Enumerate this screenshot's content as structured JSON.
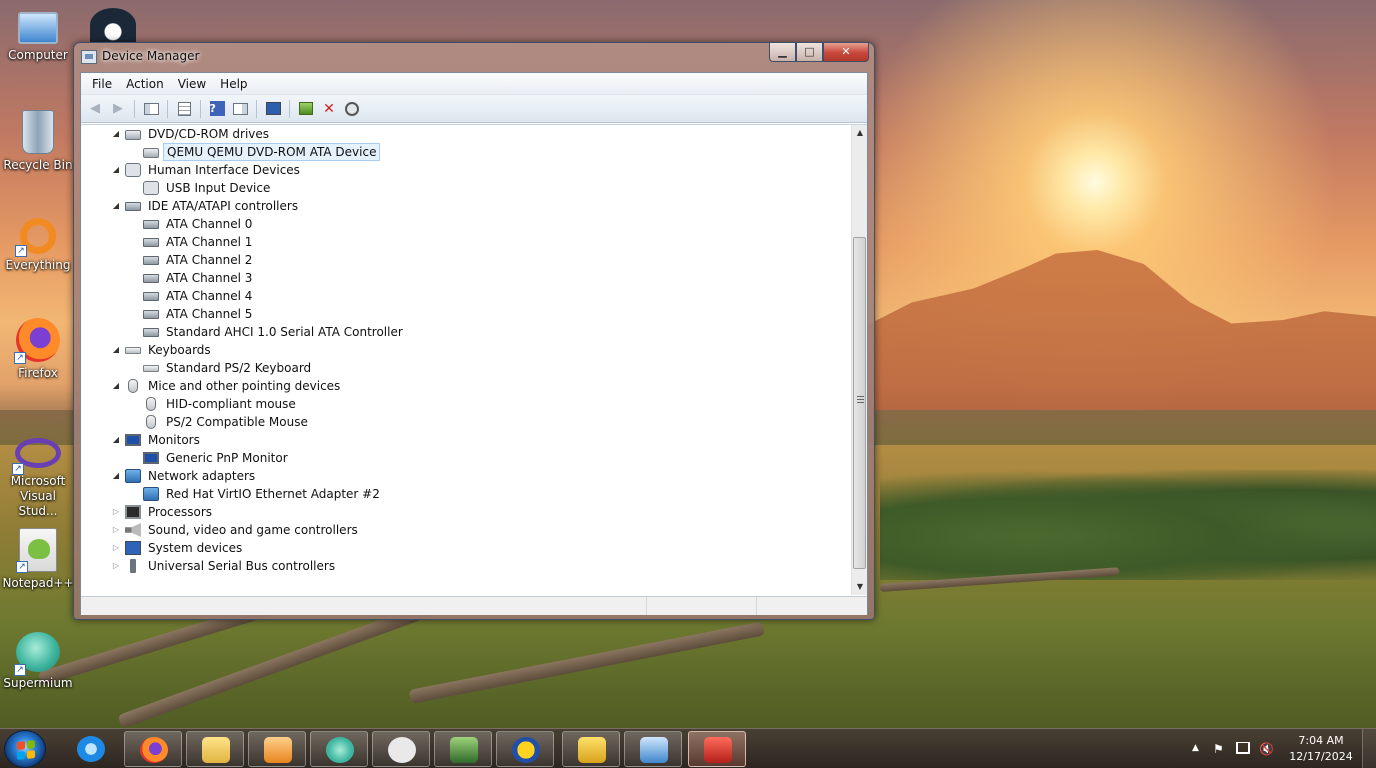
{
  "desktop": {
    "icons": [
      {
        "label": "Computer",
        "icon": "computer-icon"
      },
      {
        "label": "Recycle Bin",
        "icon": "recycle-bin-icon"
      },
      {
        "label": "Everything",
        "icon": "everything-icon"
      },
      {
        "label": "Firefox",
        "icon": "firefox-icon"
      },
      {
        "label": "Microsoft Visual Stud...",
        "icon": "visual-studio-icon"
      },
      {
        "label": "Notepad++",
        "icon": "notepad-plus-plus-icon"
      },
      {
        "label": "Supermium",
        "icon": "supermium-icon"
      }
    ]
  },
  "window": {
    "title": "Device Manager",
    "caption": {
      "minimize": "▁",
      "maximize": "□",
      "close": "✕"
    },
    "menu": [
      "File",
      "Action",
      "View",
      "Help"
    ],
    "toolbar": [
      "back",
      "forward",
      "show-hide-console-tree",
      "properties",
      "help",
      "show-action-pane",
      "scan-hardware",
      "update-driver",
      "uninstall",
      "disable"
    ]
  },
  "tree": {
    "items": [
      {
        "label": "DVD/CD-ROM drives",
        "level": 0,
        "state": "expanded",
        "icon": "dvd-drive-icon"
      },
      {
        "label": "QEMU QEMU DVD-ROM ATA Device",
        "level": 1,
        "icon": "dvd-drive-icon",
        "selected": true
      },
      {
        "label": "Human Interface Devices",
        "level": 0,
        "state": "expanded",
        "icon": "hid-icon"
      },
      {
        "label": "USB Input Device",
        "level": 1,
        "icon": "hid-icon"
      },
      {
        "label": "IDE ATA/ATAPI controllers",
        "level": 0,
        "state": "expanded",
        "icon": "ide-controller-icon"
      },
      {
        "label": "ATA Channel 0",
        "level": 1,
        "icon": "ide-controller-icon"
      },
      {
        "label": "ATA Channel 1",
        "level": 1,
        "icon": "ide-controller-icon"
      },
      {
        "label": "ATA Channel 2",
        "level": 1,
        "icon": "ide-controller-icon"
      },
      {
        "label": "ATA Channel 3",
        "level": 1,
        "icon": "ide-controller-icon"
      },
      {
        "label": "ATA Channel 4",
        "level": 1,
        "icon": "ide-controller-icon"
      },
      {
        "label": "ATA Channel 5",
        "level": 1,
        "icon": "ide-controller-icon"
      },
      {
        "label": "Standard AHCI 1.0 Serial ATA Controller",
        "level": 1,
        "icon": "ide-controller-icon"
      },
      {
        "label": "Keyboards",
        "level": 0,
        "state": "expanded",
        "icon": "keyboard-icon"
      },
      {
        "label": "Standard PS/2 Keyboard",
        "level": 1,
        "icon": "keyboard-icon"
      },
      {
        "label": "Mice and other pointing devices",
        "level": 0,
        "state": "expanded",
        "icon": "mouse-icon"
      },
      {
        "label": "HID-compliant mouse",
        "level": 1,
        "icon": "mouse-icon"
      },
      {
        "label": "PS/2 Compatible Mouse",
        "level": 1,
        "icon": "mouse-icon"
      },
      {
        "label": "Monitors",
        "level": 0,
        "state": "expanded",
        "icon": "monitor-icon"
      },
      {
        "label": "Generic PnP Monitor",
        "level": 1,
        "icon": "monitor-icon"
      },
      {
        "label": "Network adapters",
        "level": 0,
        "state": "expanded",
        "icon": "network-adapter-icon"
      },
      {
        "label": "Red Hat VirtIO Ethernet Adapter #2",
        "level": 1,
        "icon": "network-adapter-icon"
      },
      {
        "label": "Processors",
        "level": 0,
        "state": "collapsed",
        "icon": "processor-icon"
      },
      {
        "label": "Sound, video and game controllers",
        "level": 0,
        "state": "collapsed",
        "icon": "sound-icon"
      },
      {
        "label": "System devices",
        "level": 0,
        "state": "collapsed",
        "icon": "system-devices-icon"
      },
      {
        "label": "Universal Serial Bus controllers",
        "level": 0,
        "state": "collapsed",
        "icon": "usb-icon"
      }
    ]
  },
  "taskbar": {
    "pinned": [
      "internet-explorer-icon",
      "firefox-icon",
      "file-explorer-icon",
      "media-player-icon",
      "supermium-icon",
      "mullvad-browser-icon",
      "network-monitor-icon",
      "xming-icon",
      "badger-app-icon",
      "remote-desktop-icon",
      "toolbox-icon"
    ],
    "clock_time": "7:04 AM",
    "clock_date": "12/17/2024",
    "tray": [
      "show-hidden-icons-icon",
      "action-center-flag-icon",
      "network-icon",
      "volume-muted-icon"
    ]
  }
}
